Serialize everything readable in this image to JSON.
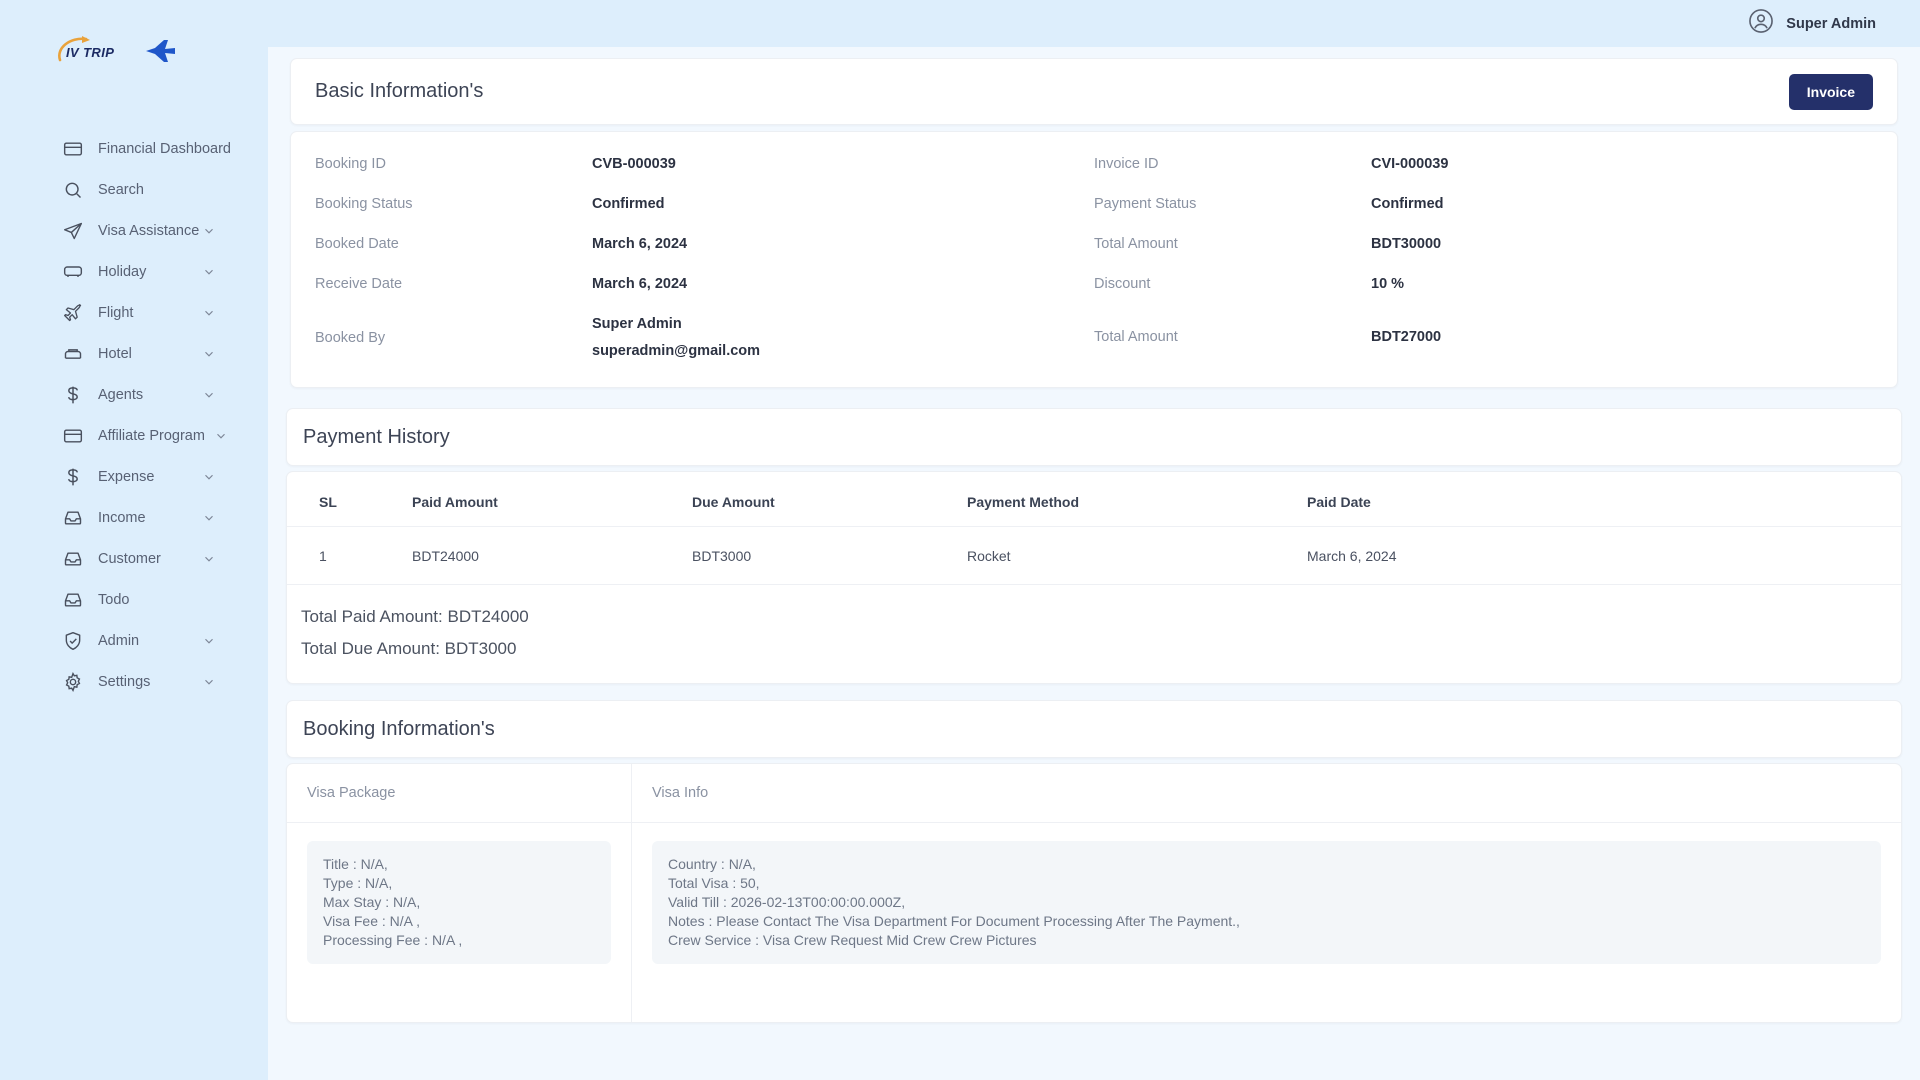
{
  "brand": {
    "name": "IV TRIP",
    "logo_icon": "airplane-logo-icon"
  },
  "topbar": {
    "user_name": "Super Admin",
    "user_icon": "user-avatar-icon"
  },
  "sidebar": {
    "items": [
      {
        "label": "Financial Dashboard",
        "icon": "card-icon",
        "expandable": false
      },
      {
        "label": "Search",
        "icon": "search-icon",
        "expandable": false
      },
      {
        "label": "Visa Assistance",
        "icon": "send-icon",
        "expandable": true
      },
      {
        "label": "Holiday",
        "icon": "bus-icon",
        "expandable": true
      },
      {
        "label": "Flight",
        "icon": "plane-icon",
        "expandable": true
      },
      {
        "label": "Hotel",
        "icon": "bed-icon",
        "expandable": true
      },
      {
        "label": "Agents",
        "icon": "dollar-icon",
        "expandable": true
      },
      {
        "label": "Affiliate Program",
        "icon": "card-icon",
        "expandable": true
      },
      {
        "label": "Expense",
        "icon": "dollar-icon",
        "expandable": true
      },
      {
        "label": "Income",
        "icon": "inbox-icon",
        "expandable": true
      },
      {
        "label": "Customer",
        "icon": "inbox-icon",
        "expandable": true
      },
      {
        "label": "Todo",
        "icon": "inbox-icon",
        "expandable": false
      },
      {
        "label": "Admin",
        "icon": "shield-icon",
        "expandable": true
      },
      {
        "label": "Settings",
        "icon": "gear-icon",
        "expandable": true
      }
    ]
  },
  "basic_information": {
    "title": "Basic Information's",
    "invoice_button": "Invoice",
    "left_fields": [
      {
        "key": "Booking ID",
        "value": "CVB-000039"
      },
      {
        "key": "Booking Status",
        "value": "Confirmed"
      },
      {
        "key": "Booked Date",
        "value": "March 6, 2024"
      },
      {
        "key": "Receive Date",
        "value": "March 6, 2024"
      }
    ],
    "booked_by": {
      "key": "Booked By",
      "name": "Super Admin",
      "email": "superadmin@gmail.com"
    },
    "right_fields": [
      {
        "key": "Invoice ID",
        "value": "CVI-000039"
      },
      {
        "key": "Payment Status",
        "value": "Confirmed"
      },
      {
        "key": "Total Amount",
        "value": "BDT30000"
      },
      {
        "key": "Discount",
        "value": "10 %"
      },
      {
        "key": "Total Amount",
        "value": "BDT27000"
      }
    ]
  },
  "payment_history": {
    "title": "Payment History",
    "columns": [
      "SL",
      "Paid Amount",
      "Due Amount",
      "Payment Method",
      "Paid Date"
    ],
    "rows": [
      {
        "sl": "1",
        "paid_amount": "BDT24000",
        "due_amount": "BDT3000",
        "payment_method": "Rocket",
        "paid_date": "March 6, 2024"
      }
    ],
    "total_paid": "Total Paid Amount: BDT24000",
    "total_due": "Total Due Amount: BDT3000"
  },
  "booking_information": {
    "title": "Booking Information's",
    "visa_package": {
      "column_title": "Visa Package",
      "lines": [
        "Title : N/A,",
        "Type : N/A,",
        "Max Stay : N/A,",
        "Visa Fee : N/A ,",
        "Processing Fee : N/A ,"
      ]
    },
    "visa_info": {
      "column_title": "Visa Info",
      "lines": [
        "Country : N/A,",
        "Total Visa : 50,",
        "Valid Till : 2026-02-13T00:00:00.000Z,",
        "Notes : Please Contact The Visa Department For Document Processing After The Payment.,",
        "Crew Service : Visa Crew Request Mid Crew Crew Pictures"
      ]
    }
  },
  "colors": {
    "sidebar_bg": "#ddeefc",
    "content_bg": "#f2f8fe",
    "invoice_button": "#24306a",
    "card_bg": "#ffffff",
    "muted_text": "#8a92a2"
  }
}
